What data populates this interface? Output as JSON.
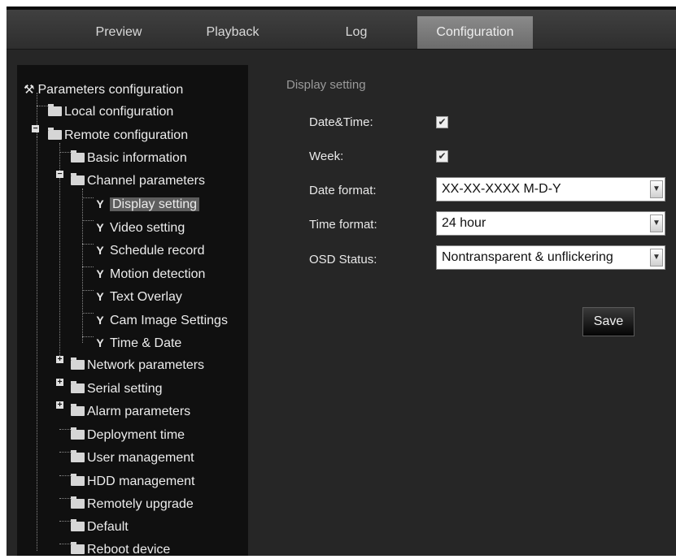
{
  "tabs": {
    "preview": "Preview",
    "playback": "Playback",
    "log": "Log",
    "configuration": "Configuration"
  },
  "tree": {
    "root": "Parameters configuration",
    "local": "Local configuration",
    "remote": "Remote configuration",
    "basic": "Basic information",
    "channel": "Channel parameters",
    "display": "Display setting",
    "video": "Video setting",
    "schedule": "Schedule record",
    "motion": "Motion detection",
    "text_overlay": "Text Overlay",
    "cam_image": "Cam Image Settings",
    "time_date": "Time & Date",
    "network": "Network parameters",
    "serial": "Serial setting",
    "alarm": "Alarm parameters",
    "deployment": "Deployment time",
    "user": "User management",
    "hdd": "HDD management",
    "upgrade": "Remotely upgrade",
    "default": "Default",
    "reboot": "Reboot device"
  },
  "form": {
    "title": "Display setting",
    "datetime_label": "Date&Time:",
    "datetime_checked": true,
    "week_label": "Week:",
    "week_checked": true,
    "date_format_label": "Date format:",
    "date_format_value": "XX-XX-XXXX M-D-Y",
    "time_format_label": "Time format:",
    "time_format_value": "24 hour",
    "osd_label": "OSD Status:",
    "osd_value": "Nontransparent & unflickering",
    "check_glyph": "✔",
    "save": "Save"
  },
  "icons": [
    "folder-icon",
    "wrench-icon",
    "expander-icon",
    "check-icon",
    "chevron-down-icon",
    "tools-icon"
  ]
}
